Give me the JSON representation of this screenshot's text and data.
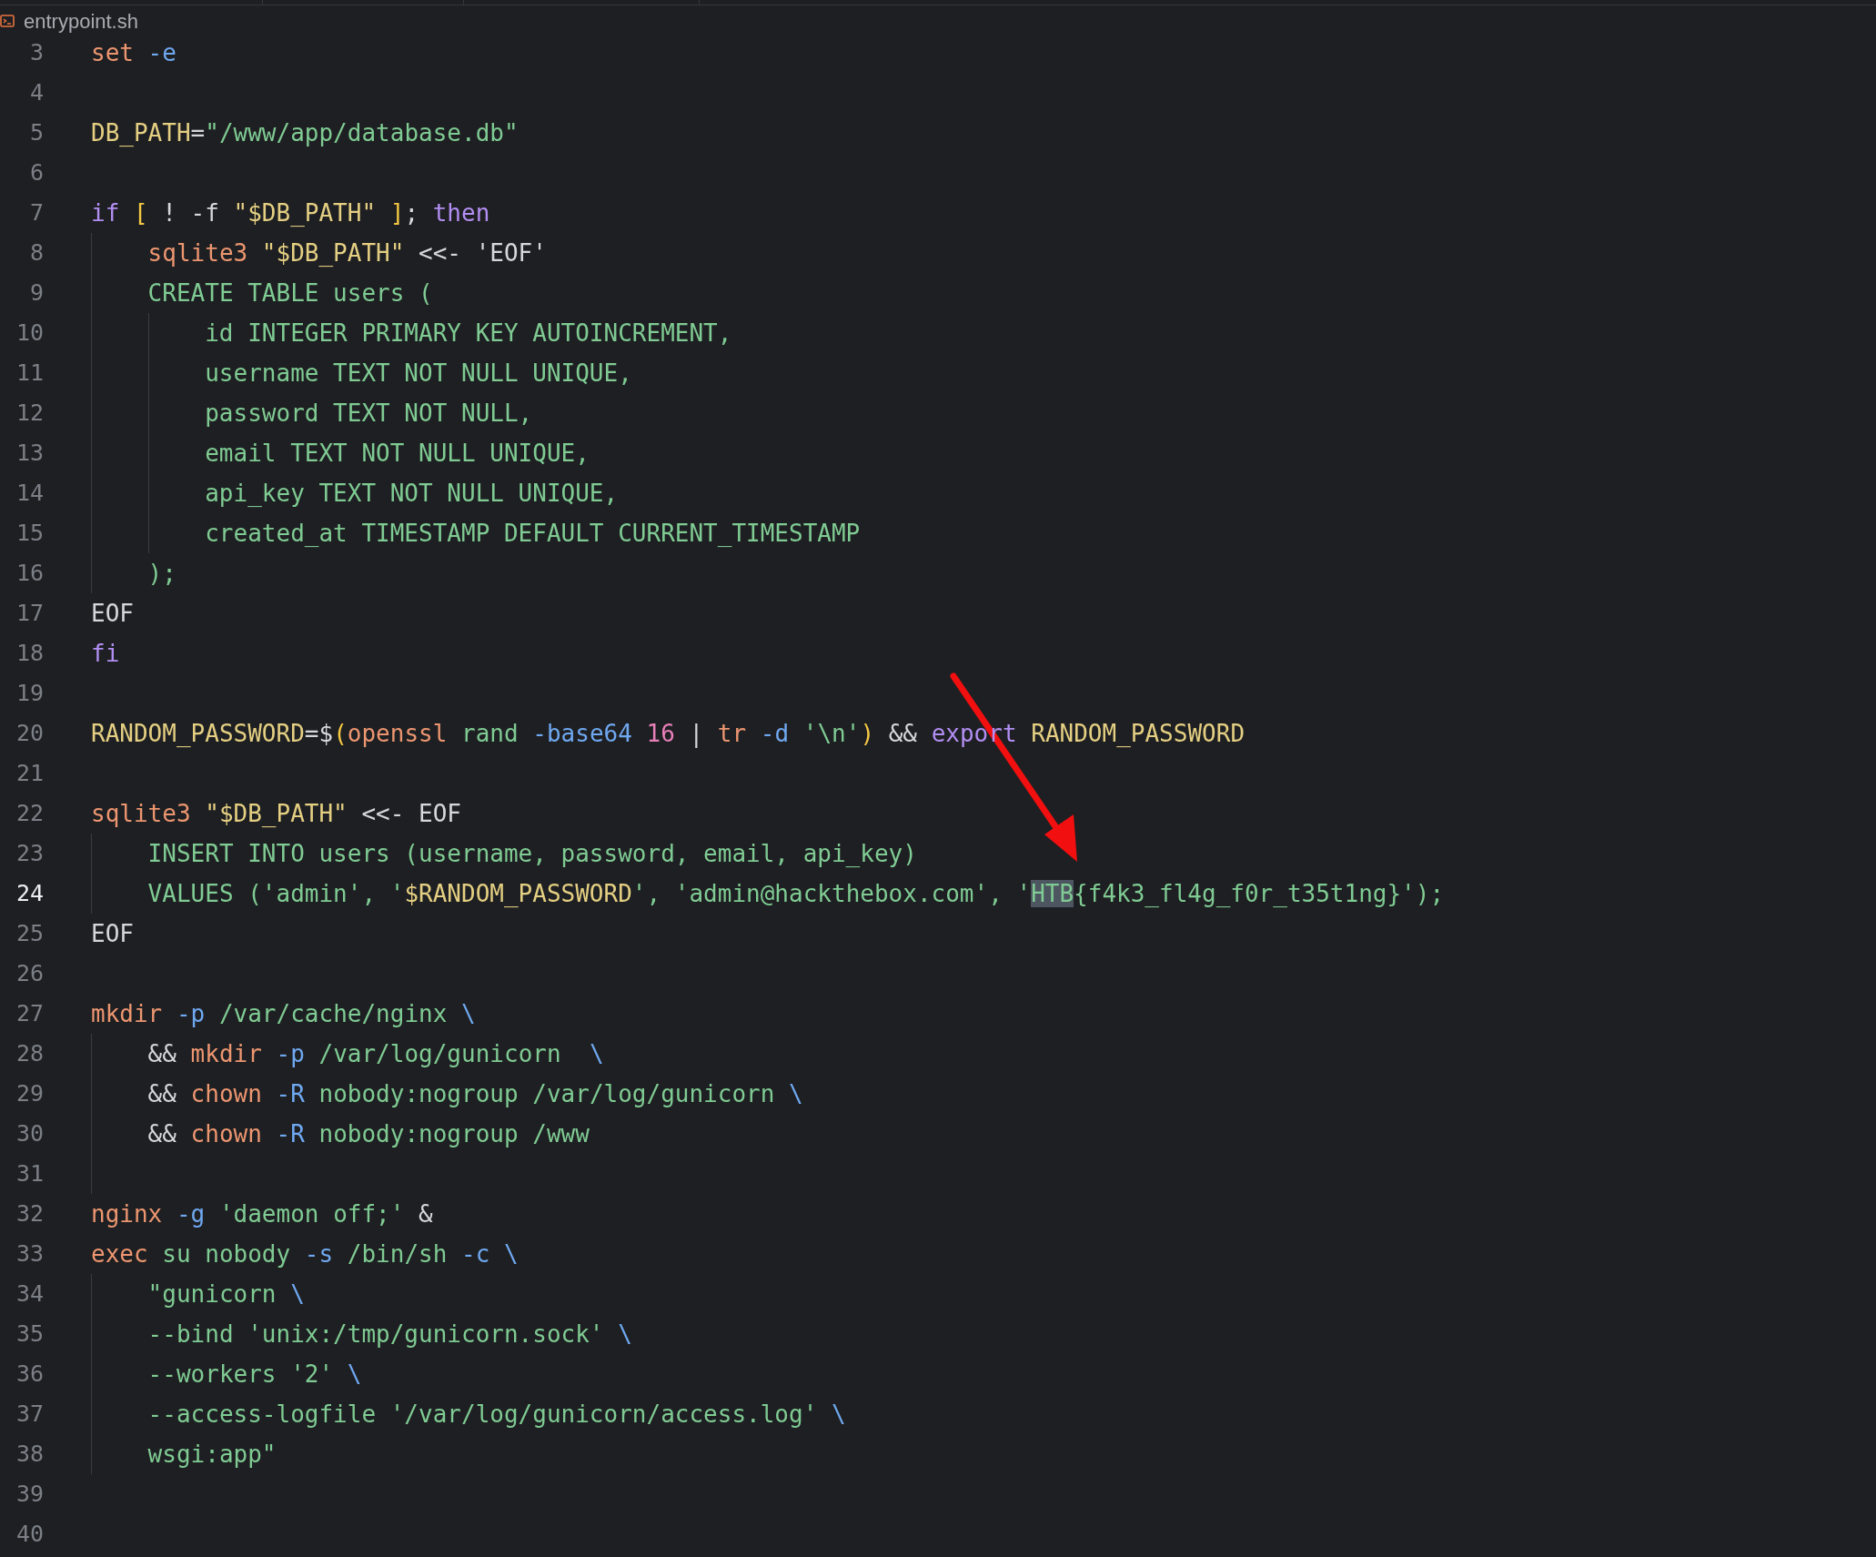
{
  "file_header": {
    "filename": "entrypoint.sh"
  },
  "lines": [
    {
      "number": "3",
      "current": false,
      "tokens": [
        {
          "kind": "cmd",
          "text": "set"
        },
        {
          "kind": "flag",
          "text": " -e"
        }
      ]
    },
    {
      "number": "4",
      "current": false
    },
    {
      "number": "5",
      "current": false,
      "tokens": [
        {
          "kind": "var",
          "text": "DB_PATH"
        },
        {
          "kind": "plain",
          "text": "="
        },
        {
          "kind": "str",
          "text": "\"/www/app/database.db\""
        }
      ]
    },
    {
      "number": "6",
      "current": false
    },
    {
      "number": "7",
      "current": false,
      "tokens": [
        {
          "kind": "kw",
          "text": "if"
        },
        {
          "kind": "paren",
          "text": " ["
        },
        {
          "kind": "plain",
          "text": " ! -f "
        },
        {
          "kind": "var",
          "text": "\"$DB_PATH\""
        },
        {
          "kind": "paren",
          "text": " ]"
        },
        {
          "kind": "plain",
          "text": "; "
        },
        {
          "kind": "kw",
          "text": "then"
        }
      ],
      "children": [
        {
          "number": "8",
          "current": false,
          "tokens": [
            {
              "kind": "cmd",
              "text": "sqlite3"
            },
            {
              "kind": "var",
              "text": " \"$DB_PATH\""
            },
            {
              "kind": "plain",
              "text": " <<- 'EOF'"
            }
          ]
        },
        {
          "number": "9",
          "current": false,
          "tokens": [
            {
              "kind": "str",
              "text": "CREATE TABLE users ("
            }
          ],
          "children": [
            {
              "number": "10",
              "current": false,
              "tokens": [
                {
                  "kind": "str",
                  "text": "id INTEGER PRIMARY KEY AUTOINCREMENT,"
                }
              ]
            },
            {
              "number": "11",
              "current": false,
              "tokens": [
                {
                  "kind": "str",
                  "text": "username TEXT NOT NULL UNIQUE,"
                }
              ]
            },
            {
              "number": "12",
              "current": false,
              "tokens": [
                {
                  "kind": "str",
                  "text": "password TEXT NOT NULL,"
                }
              ]
            },
            {
              "number": "13",
              "current": false,
              "tokens": [
                {
                  "kind": "str",
                  "text": "email TEXT NOT NULL UNIQUE,"
                }
              ]
            },
            {
              "number": "14",
              "current": false,
              "tokens": [
                {
                  "kind": "str",
                  "text": "api_key TEXT NOT NULL UNIQUE,"
                }
              ]
            },
            {
              "number": "15",
              "current": false,
              "tokens": [
                {
                  "kind": "str",
                  "text": "created_at TIMESTAMP DEFAULT CURRENT_TIMESTAMP"
                }
              ]
            }
          ]
        },
        {
          "number": "16",
          "current": false,
          "tokens": [
            {
              "kind": "str",
              "text": ");"
            }
          ]
        }
      ]
    },
    {
      "number": "17",
      "current": false,
      "tokens": [
        {
          "kind": "plain",
          "text": "EOF"
        }
      ]
    },
    {
      "number": "18",
      "current": false,
      "tokens": [
        {
          "kind": "kw",
          "text": "fi"
        }
      ]
    },
    {
      "number": "19",
      "current": false
    },
    {
      "number": "20",
      "current": false,
      "tokens": [
        {
          "kind": "var",
          "text": "RANDOM_PASSWORD"
        },
        {
          "kind": "plain",
          "text": "=$"
        },
        {
          "kind": "paren",
          "text": "("
        },
        {
          "kind": "cmd",
          "text": "openssl"
        },
        {
          "kind": "str",
          "text": " rand"
        },
        {
          "kind": "flag",
          "text": " -base64"
        },
        {
          "kind": "num",
          "text": " 16"
        },
        {
          "kind": "plain",
          "text": " | "
        },
        {
          "kind": "cmd",
          "text": "tr"
        },
        {
          "kind": "flag",
          "text": " -d"
        },
        {
          "kind": "str",
          "text": " '\\n'"
        },
        {
          "kind": "paren",
          "text": ")"
        },
        {
          "kind": "plain",
          "text": " && "
        },
        {
          "kind": "kw",
          "text": "export"
        },
        {
          "kind": "var",
          "text": " RANDOM_PASSWORD"
        }
      ]
    },
    {
      "number": "21",
      "current": false
    },
    {
      "number": "22",
      "current": false,
      "tokens": [
        {
          "kind": "cmd",
          "text": "sqlite3"
        },
        {
          "kind": "var",
          "text": " \"$DB_PATH\""
        },
        {
          "kind": "plain",
          "text": " <<- EOF"
        }
      ],
      "children": [
        {
          "number": "23",
          "current": false,
          "tokens": [
            {
              "kind": "str",
              "text": "INSERT INTO users (username, password, email, api_key)"
            }
          ]
        },
        {
          "number": "24",
          "current": true,
          "tokens": [
            {
              "kind": "str",
              "text": "VALUES ('admin', '"
            },
            {
              "kind": "var",
              "text": "$RANDOM_PASSWORD"
            },
            {
              "kind": "str",
              "text": "', 'admin@hackthebox.com', '"
            },
            {
              "kind": "sel",
              "text": "HTB"
            },
            {
              "kind": "str",
              "text": "{f4k3_fl4g_f0r_t35t1ng}');"
            }
          ]
        }
      ]
    },
    {
      "number": "25",
      "current": false,
      "tokens": [
        {
          "kind": "plain",
          "text": "EOF"
        }
      ]
    },
    {
      "number": "26",
      "current": false
    },
    {
      "number": "27",
      "current": false,
      "tokens": [
        {
          "kind": "cmd",
          "text": "mkdir"
        },
        {
          "kind": "flag",
          "text": " -p"
        },
        {
          "kind": "str",
          "text": " /var/cache/nginx"
        },
        {
          "kind": "flag",
          "text": " \\"
        }
      ],
      "children": [
        {
          "number": "28",
          "current": false,
          "tokens": [
            {
              "kind": "plain",
              "text": "&& "
            },
            {
              "kind": "cmd",
              "text": "mkdir"
            },
            {
              "kind": "flag",
              "text": " -p"
            },
            {
              "kind": "str",
              "text": " /var/log/gunicorn"
            },
            {
              "kind": "flag",
              "text": "  \\"
            }
          ]
        },
        {
          "number": "29",
          "current": false,
          "tokens": [
            {
              "kind": "plain",
              "text": "&& "
            },
            {
              "kind": "cmd",
              "text": "chown"
            },
            {
              "kind": "flag",
              "text": " -R"
            },
            {
              "kind": "str",
              "text": " nobody:nogroup /var/log/gunicorn"
            },
            {
              "kind": "flag",
              "text": " \\"
            }
          ]
        },
        {
          "number": "30",
          "current": false,
          "tokens": [
            {
              "kind": "plain",
              "text": "&& "
            },
            {
              "kind": "cmd",
              "text": "chown"
            },
            {
              "kind": "flag",
              "text": " -R"
            },
            {
              "kind": "str",
              "text": " nobody:nogroup /www"
            }
          ]
        },
        {
          "number": "31",
          "current": false
        }
      ]
    },
    {
      "number": "32",
      "current": false,
      "tokens": [
        {
          "kind": "cmd",
          "text": "nginx"
        },
        {
          "kind": "flag",
          "text": " -g"
        },
        {
          "kind": "str",
          "text": " 'daemon off;'"
        },
        {
          "kind": "plain",
          "text": " &"
        }
      ]
    },
    {
      "number": "33",
      "current": false,
      "tokens": [
        {
          "kind": "cmd",
          "text": "exec"
        },
        {
          "kind": "str",
          "text": " su nobody"
        },
        {
          "kind": "flag",
          "text": " -s"
        },
        {
          "kind": "str",
          "text": " /bin/sh"
        },
        {
          "kind": "flag",
          "text": " -c \\"
        }
      ],
      "children": [
        {
          "number": "34",
          "current": false,
          "tokens": [
            {
              "kind": "str",
              "text": "\"gunicorn"
            },
            {
              "kind": "flag",
              "text": " \\"
            }
          ]
        },
        {
          "number": "35",
          "current": false,
          "tokens": [
            {
              "kind": "str",
              "text": "--bind 'unix:/tmp/gunicorn.sock'"
            },
            {
              "kind": "flag",
              "text": " \\"
            }
          ]
        },
        {
          "number": "36",
          "current": false,
          "tokens": [
            {
              "kind": "str",
              "text": "--workers '2'"
            },
            {
              "kind": "flag",
              "text": " \\"
            }
          ]
        },
        {
          "number": "37",
          "current": false,
          "tokens": [
            {
              "kind": "str",
              "text": "--access-logfile '/var/log/gunicorn/access.log'"
            },
            {
              "kind": "flag",
              "text": " \\"
            }
          ]
        },
        {
          "number": "38",
          "current": false,
          "tokens": [
            {
              "kind": "str",
              "text": "wsgi:app\""
            }
          ]
        }
      ]
    },
    {
      "number": "39",
      "current": false
    },
    {
      "number": "40",
      "current": false
    }
  ]
}
